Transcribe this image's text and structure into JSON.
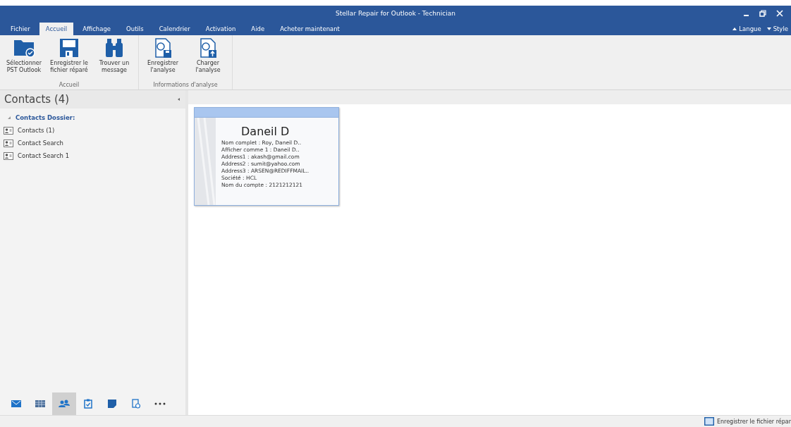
{
  "window": {
    "title": "Stellar Repair for Outlook - Technician"
  },
  "tabs": [
    {
      "label": "Fichier",
      "selected": false
    },
    {
      "label": "Accueil",
      "selected": true
    },
    {
      "label": "Affichage",
      "selected": false
    },
    {
      "label": "Outils",
      "selected": false
    },
    {
      "label": "Calendrier",
      "selected": false
    },
    {
      "label": "Activation",
      "selected": false
    },
    {
      "label": "Aide",
      "selected": false
    },
    {
      "label": "Acheter maintenant",
      "selected": false
    }
  ],
  "ribbon_right": [
    {
      "label": "Langue",
      "kind": "up"
    },
    {
      "label": "Style",
      "kind": "down"
    }
  ],
  "ribbon_groups": [
    {
      "label": "Accueil",
      "buttons": [
        {
          "label": "Sélectionner PST Outlook",
          "kind": "folder"
        },
        {
          "label": "Enregistrer le fichier réparé",
          "kind": "save"
        },
        {
          "label": "Trouver un message",
          "kind": "find"
        }
      ]
    },
    {
      "label": "Informations d'analyse",
      "buttons": [
        {
          "label": "Enregistrer l'analyse",
          "kind": "doc-save"
        },
        {
          "label": "Charger l'analyse",
          "kind": "doc-load"
        }
      ]
    }
  ],
  "sidebar": {
    "title": "Contacts (4)",
    "folder": "Contacts Dossier:",
    "items": [
      "Contacts (1)",
      "Contact Search",
      "Contact Search 1"
    ]
  },
  "nav": [
    {
      "kind": "mail",
      "selected": false
    },
    {
      "kind": "calendar",
      "selected": false
    },
    {
      "kind": "contacts",
      "selected": true
    },
    {
      "kind": "tasks",
      "selected": false
    },
    {
      "kind": "notes",
      "selected": false
    },
    {
      "kind": "journal",
      "selected": false
    },
    {
      "kind": "more",
      "selected": false
    }
  ],
  "card": {
    "name": "Daneil D",
    "lines": [
      "Nom complet : Roy, Daneil D..",
      "Afficher comme 1 : Daneil D..",
      "Address1 : akash@gmail.com",
      "Address2 : sumit@yahoo.com",
      "Address3 : ARSEN@REDIFFMAIL..",
      "Société : HCL",
      "Nom du compte : 2121212121"
    ]
  },
  "status_bar": {
    "label": "Enregistrer le fichier répar"
  }
}
